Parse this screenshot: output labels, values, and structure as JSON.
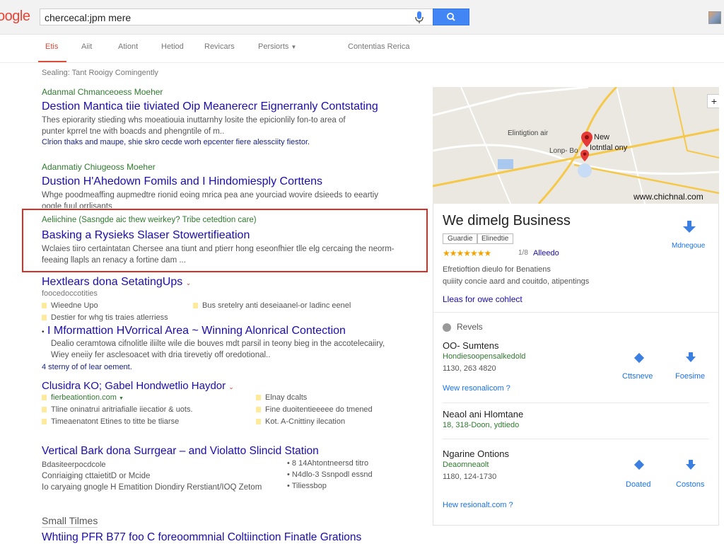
{
  "header": {
    "logo": "oogle",
    "search_value": "chercecal:jpm mere"
  },
  "tabs": [
    "Etis",
    "Aiit",
    "Ationt",
    "Hetiod",
    "Revicars",
    "Persiorts",
    "Contentias Rerica"
  ],
  "results_stats": "Sealing: Tant Rooigy Comingently",
  "results": [
    {
      "url": "Adanmal Chmanceoess Moeher",
      "title": "Destion Mantica tiie tiviated Oip Meanerecr Eignerranly Contstating",
      "snippet": [
        "Thes epiorarity stieding whs moeatiouia inuttarnhy losite the epicionlily fon-to area of",
        "punter kprrel tne with boacds and phengntile of m.."
      ],
      "link": "Clrion thaks and maupe, shie skro cecde worh epcenter fiere alessciity fiestor."
    },
    {
      "url": "Adanmatiy Chiugeoss Moeher",
      "title": "Dustion H'Ahedown Fomils and I Hindomiesply Corttens",
      "snippet": [
        "Whge poodmeaffing aupmedtre rionid eoing mrica pea ane yourciad wovire dsieeds to eeartiy",
        "oogle fuul orrlisants"
      ]
    },
    {
      "url": "Aeliichine (Sasngde aic thew weirkey? Tribe cetedtion care)",
      "title": "Basking a Rysieks Slaser Stowertifieation",
      "snippet": [
        "Wclaies tiiro certaintatan  Chersee ana tiunt and ptierr hong eseonfhier tlle elg cercaing the neorm-",
        "feeaing llapls an renacy a fortine dam ..."
      ]
    }
  ],
  "result4": {
    "title": "Hextlears dona SetatingUps",
    "url": "foocedoccotities",
    "sitelinks": [
      "Wieedne Upo",
      "Bus sretelry anti deseiaanel-or ladinc eenel",
      "Destier for whg tis traies atlerriess"
    ]
  },
  "result5": {
    "title": "I Mformattion HVorrical Area ~ Winning Alonrical Contection",
    "snippet": [
      "Dealio ceramtowa cifnolitle iliilte wile die bouves mdt parsil in teony bieg in the accotelecaiiry,",
      "Wiey eneiiy fer asclesoacet with dria tirevetiy off oredotional.."
    ],
    "link": "4 sterny of of lear oement."
  },
  "result6": {
    "title": "Clusidra KO; Gabel Hondwetlio Haydor",
    "url": "fierbeationtion.com",
    "sitelinks": [
      "Tline oninatrui aritriafialle iiecatior & uots.",
      "Timeaenatont Etines to titte be tliarse",
      "Elnay dcalts",
      "Fine duoitentieeeee do tmened",
      "Kot. A-Cnittiny ilecation"
    ]
  },
  "result7": {
    "title": "Vertical Bark dona Surrgear – and Violatto Slincid Station",
    "snippet": [
      "Bdasiteerpocdcole",
      "Conriaiging cttaietitD or Mcide",
      "Io caryaing gnogle H Ematition Diondiry Rerstiant/IOQ Zetom"
    ],
    "sitelinks": [
      "8 14Ahtontneersd titro",
      "N4dlo-3 Ssnpodl essnd",
      "Tiliessbop"
    ]
  },
  "small_heading": "Small Tilmes",
  "result8_title": "Whtiing PFR B77 foo C foreoommnial Coltiinction Finatle Grations",
  "panel": {
    "map_caption": "www.chichnal.com",
    "map_labels": [
      "Elintigtion air",
      "Lonp- Bo",
      "New",
      "Iotntlal ony"
    ],
    "name": "We dimelg Business",
    "chips": [
      "Guardie",
      "Elinedtie"
    ],
    "stars": "★★★★★★★",
    "rating_num": "1/8",
    "rating_link": "Alleedo",
    "desc": [
      "Efretioftion dieulo for Benatiens",
      "quiiity concie aard and couitdo, atipentings"
    ],
    "link1": "Lleas for owe cohlect",
    "action_top": "Mdnegoue",
    "section_title": "Revels",
    "entries": [
      {
        "name": "OO- Sumtens",
        "sub": "Hondiesoopensalkedold",
        "phone": "1130, 263 4820",
        "link": "Wew resonalicom ?"
      },
      {
        "name": "Neaol ani Hlomtane",
        "sub": "18, 318-Doon, ydtiedo"
      },
      {
        "name": "Ngarine Ontions",
        "sub": "Deaomneaolt",
        "phone": "1180, 124-1730",
        "link": "Hew resionalt.com ?"
      }
    ],
    "actions_a": [
      "Cttsneve",
      "Foesime"
    ],
    "actions_b": [
      "Doated",
      "Costons"
    ]
  },
  "colors": {
    "link": "#1a0dab",
    "green": "#2f7a2f",
    "red_box": "#d93025",
    "accent": "#4285f4"
  }
}
